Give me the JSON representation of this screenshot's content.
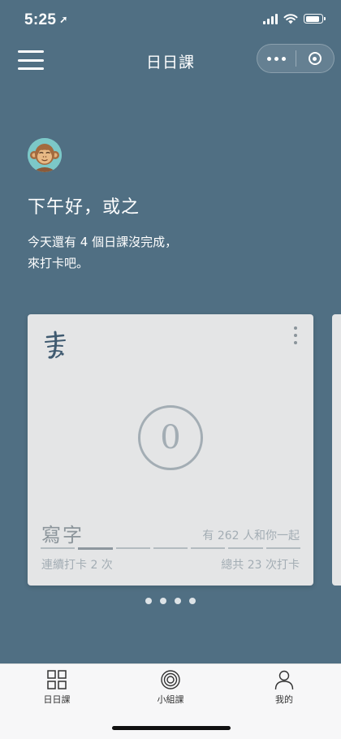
{
  "status_bar": {
    "time": "5:25",
    "battery_level": 0.85
  },
  "nav": {
    "title": "日日課"
  },
  "greeting": "下午好，或之",
  "subtitle_line1": "今天還有 4 個日課沒完成，",
  "subtitle_line2": "來打卡吧。",
  "card": {
    "count": "0",
    "title": "寫字",
    "people": "有 262 人和你一起",
    "streak": "連續打卡 2 次",
    "total": "總共 23 次打卡",
    "progress_filled_segment": 2,
    "progress_segments": 7
  },
  "pagination": {
    "pages": 4,
    "current": 1
  },
  "tabs": [
    {
      "label": "日日課",
      "icon": "grid-icon"
    },
    {
      "label": "小組課",
      "icon": "target-icon"
    },
    {
      "label": "我的",
      "icon": "person-icon"
    }
  ],
  "colors": {
    "background": "#506F83",
    "card": "#E4E5E6",
    "tabbar": "#F7F7F8"
  }
}
